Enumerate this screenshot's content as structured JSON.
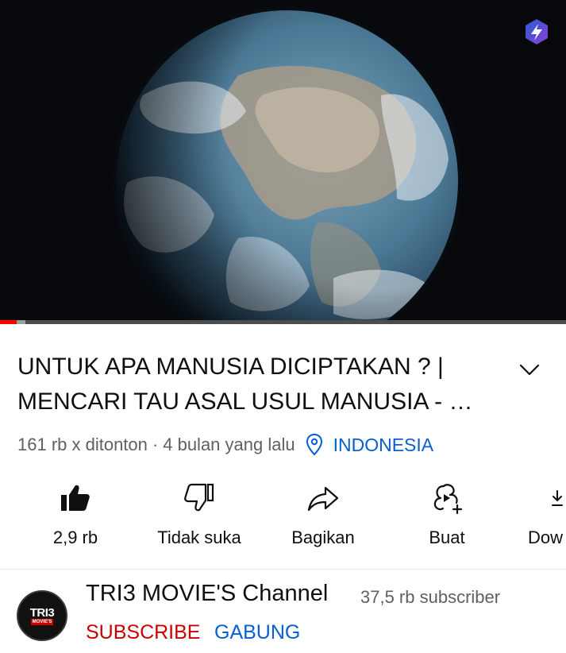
{
  "video": {
    "title": "UNTUK APA MANUSIA DICIPTAKAN ? | MENCARI TAU ASAL USUL MANUSIA  - …",
    "progress_played": 0.03,
    "progress_buffered": 0.045
  },
  "meta": {
    "views": "161 rb x ditonton",
    "separator": "·",
    "uploaded": "4 bulan yang lalu",
    "location": "INDONESIA"
  },
  "actions": [
    {
      "label": "2,9 rb",
      "icon": "thumbs-up-icon"
    },
    {
      "label": "Tidak suka",
      "icon": "thumbs-down-icon"
    },
    {
      "label": "Bagikan",
      "icon": "share-icon"
    },
    {
      "label": "Buat",
      "icon": "remix-icon"
    },
    {
      "label": "Dow",
      "icon": "download-icon"
    }
  ],
  "channel": {
    "name": "TRI3 MOVIE'S Channel",
    "subscribers": "37,5 rb subscriber",
    "subscribe_label": "SUBSCRIBE",
    "join_label": "GABUNG",
    "avatar_text": "TRI3",
    "avatar_subtext": "MOVIE'S"
  },
  "colors": {
    "subscribe": "#cc0000",
    "link": "#065fd4",
    "progress": "#ff0000"
  }
}
